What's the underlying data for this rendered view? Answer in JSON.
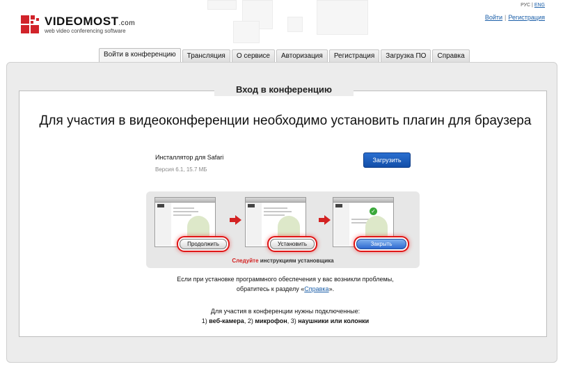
{
  "header": {
    "brand_name": "VIDEOMOST",
    "brand_domain": ".com",
    "brand_tagline": "web video conferencing software",
    "lang_ru": "РУС",
    "lang_separator": "|",
    "lang_en": "ENG",
    "login_link": "Войти",
    "auth_separator": "|",
    "register_link": "Регистрация"
  },
  "tabs": [
    {
      "label": "Войти в конференцию",
      "active": true
    },
    {
      "label": "Трансляция"
    },
    {
      "label": "О сервисе"
    },
    {
      "label": "Авторизация"
    },
    {
      "label": "Регистрация"
    },
    {
      "label": "Загрузка ПО"
    },
    {
      "label": "Справка"
    }
  ],
  "main": {
    "section_title": "Вход в конференцию",
    "headline": "Для участия в видеоконференции необходимо установить плагин для браузера",
    "installer_name": "Инсталлятор для Safari",
    "installer_version": "Версия 6.1, 15.7 МБ",
    "download_button": "Загрузить",
    "steps": {
      "step1_button": "Продолжить",
      "step2_button": "Установить",
      "step3_button": "Закрыть",
      "follow_highlight": "Следуйте",
      "follow_rest": " инструкциям установщика"
    },
    "help_prefix": "Если при установке программного обеспечения у вас возникли проблемы, обратитесь к разделу «",
    "help_link": "Справка",
    "help_suffix": "».",
    "req_line1": "Для участия в конференции нужны подключенные:",
    "req_n1": "1) ",
    "req_webcam": "веб-камера",
    "req_n2": ", 2) ",
    "req_mic": "микрофон",
    "req_n3": ", 3) ",
    "req_headphones": "наушники или колонки"
  },
  "colors": {
    "brand_red": "#d1232a",
    "link_blue": "#1a5ea8",
    "button_blue": "#124ea8",
    "highlight_red": "#e01414"
  }
}
